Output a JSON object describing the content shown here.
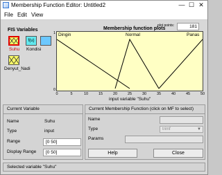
{
  "window": {
    "title": "Membership Function Editor: Untitled2",
    "icon": "matlab-window-icon"
  },
  "window_controls": {
    "minimize": "—",
    "maximize": "☐",
    "close": "✕"
  },
  "menu": [
    "File",
    "Edit",
    "View"
  ],
  "fis": {
    "heading": "FIS Variables",
    "inputs": [
      {
        "label": "Suhu",
        "selected": true
      },
      {
        "label": "Denyut_Nadi",
        "selected": false
      }
    ],
    "function_box_label": "f(u)",
    "outputs": [
      {
        "label": "Kondisi"
      }
    ]
  },
  "plot": {
    "title": "Membership function plots",
    "points_label": "plot points:",
    "points_value": "181",
    "mf_labels": [
      "Dingin",
      "Normal",
      "Panas"
    ]
  },
  "chart_data": {
    "type": "line",
    "xlabel": "input variable \"Suhu\"",
    "xlim": [
      0,
      50
    ],
    "ylim": [
      0,
      1
    ],
    "xticks": [
      "0",
      "5",
      "10",
      "15",
      "20",
      "25",
      "30",
      "35",
      "40",
      "45",
      "50"
    ],
    "yticks": [
      "0",
      "0.5",
      "1"
    ],
    "series": [
      {
        "name": "Dingin",
        "shape": "trimf",
        "x": [
          0,
          0,
          25
        ],
        "y": [
          1,
          1,
          0
        ]
      },
      {
        "name": "Normal",
        "shape": "trimf",
        "x": [
          20,
          25,
          35
        ],
        "y": [
          0,
          1,
          0
        ]
      },
      {
        "name": "Panas",
        "shape": "trimf",
        "x": [
          35,
          50,
          50
        ],
        "y": [
          0,
          1,
          1
        ]
      }
    ],
    "colors": {
      "curve": "#000000",
      "background": "#ffffc4"
    }
  },
  "current_variable": {
    "heading": "Current Variable",
    "name_label": "Name",
    "name_value": "Suhu",
    "type_label": "Type",
    "type_value": "input",
    "range_label": "Range",
    "range_value": "[0 50]",
    "display_range_label": "Display Range",
    "display_range_value": "[0 50]"
  },
  "current_mf": {
    "heading": "Current Membership Function (click on MF to select)",
    "name_label": "Name",
    "name_value": "",
    "type_label": "Type",
    "type_value": "trimf",
    "params_label": "Params",
    "params_value": ""
  },
  "buttons": {
    "help": "Help",
    "close": "Close"
  },
  "status": "Selected variable \"Suhu\""
}
